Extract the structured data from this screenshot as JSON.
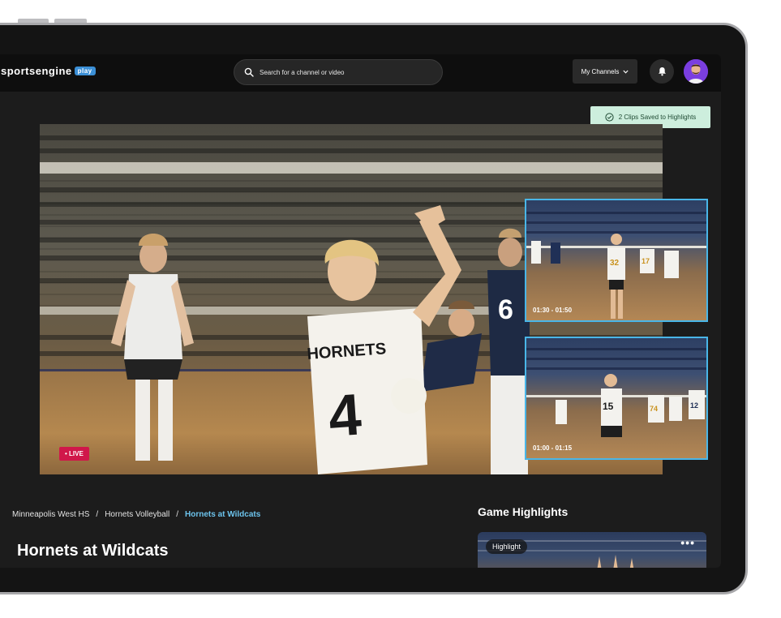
{
  "header": {
    "logo_text": "sportsengine",
    "logo_badge": "play",
    "search_placeholder": "Search for a channel or video",
    "channels_label": "My Channels",
    "icons": {
      "search": "search-icon",
      "chevron": "chevron-down-icon",
      "bell": "bell-icon",
      "avatar": "user-avatar"
    }
  },
  "toast": {
    "text": "2 Clips Saved to Highlights",
    "icon": "check-circle-icon"
  },
  "video": {
    "live_label": "• LIVE",
    "jersey_text": "HORNETS",
    "jersey_number": "4"
  },
  "clips": [
    {
      "time": "01:30 - 01:50"
    },
    {
      "time": "01:00 - 01:15"
    }
  ],
  "breadcrumb": {
    "items": [
      "Minneapolis West HS",
      "Hornets Volleyball",
      "Hornets at Wildcats"
    ],
    "separator": "/"
  },
  "page_title": "Hornets at Wildcats",
  "highlights": {
    "title": "Game Highlights",
    "card_label": "Highlight",
    "more_label": "•••"
  },
  "colors": {
    "accent": "#49b6e8",
    "live": "#d0174a",
    "toast_bg": "#cdeedd",
    "avatar_bg": "#7a3ee0",
    "badge": "#3b8fd6"
  }
}
